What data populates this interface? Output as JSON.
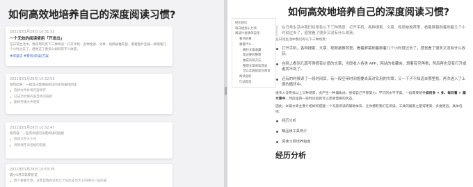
{
  "left": {
    "title": "如何高效地培养自己的深度阅读习惯?",
    "cards": [
      {
        "time": "2021年01月29日 10:51:53",
        "title": "一个无效的阅读使用「开发出」",
        "body": "在日常生活中，我常用的有下三种阅读：打开手机、各种搜索、文章、视频被推荐里，看着图片还被一刷刷看几个小时过去了。感觉这了要多么如何有不少收获。",
        "tags": "#阅读法  #要有/阅读/方案"
      },
      {
        "time": "2021年01月29日 10:52:55",
        "title": "经历起来：一般自己能做成阅读的主动查找阅读",
        "items": [
          "选择文件并将内容保存",
          "已成功文摘内容自动的链接",
          "删除存储文件链接"
        ]
      },
      {
        "time": "2021年01月29日 10:52:47",
        "title": "将内容：一些有价值的深度阅读的链接",
        "items": [
          "阅读文件大小对",
          "待到保存对话框的链接"
        ]
      },
      {
        "time": "2021年01月29日 10:53:36",
        "sub": "最小6月日常安装说",
        "items": [
          "尝下看看文章，注意自我阅读有几个在此成为大小同样的一些内容"
        ]
      }
    ]
  },
  "toc": [
    {
      "label": "经历经历",
      "level": 1
    },
    {
      "label": "每日规划十七项",
      "level": 1
    },
    {
      "label": "阅读计划清单安排",
      "level": 1
    },
    {
      "label": "看书的事",
      "level": 2
    },
    {
      "label": "要看什么…",
      "level": 2
    },
    {
      "label": "摘抄文章收藏",
      "level": 3
    },
    {
      "label": "笔记要有整理",
      "level": 3
    },
    {
      "label": "做成有效方法",
      "level": 3
    },
    {
      "label": "整理文章阅读目录",
      "level": 3
    },
    {
      "label": "可以实施前是对阅读",
      "level": 3
    },
    {
      "label": "阅读总结",
      "level": 2
    },
    {
      "label": "行动反思",
      "level": 2
    }
  ],
  "article": {
    "title": "如何高效地培养自己的深度阅读习惯?",
    "quote": "在日常生活中我们经常有以下三种场景：打开手机，各种搜索、文章、视频被推荐里，看着屏幕刷着刷着几个小时就过去了，感觉看了很多又没有什么收获。",
    "intro": "在日常生活中我们有以下三种场景：",
    "bullets": [
      "打开手机，各种搜索、文章、视频被推荐里，看着屏幕刷着刷着几个小时就过去了，感觉看了很多又没有什么收获。",
      "在网上看到几篇写得很有价值的文章，当即收入各类 APP，网站的收藏夹，想着有空再看，然后再也没有打开或者找不到了。",
      "还有的时候读了一段时间后，有一段空闲时间想要去真对实用的文章，又一下子不知道去哪里找，再次进入了上面的循环中。"
    ],
    "para1_start": "很多人没有找以上三种场景，会产生一种偏焦虑，觉得自己不够努力，学习的水平不高。一段需要培养",
    "para1_bold": "如何多 ✕ 多、每日看 ✕ 篇文章中",
    "para1_end": "，然后坚持一段时间后就可以走到需要的状态。",
    "para2": "因此，本篇文章主要介绍如何搭建一个深度阅读的辅助体系，让你拥有我们在阅读，工具的搬家之量得更高，多维更远，具体包括：",
    "short_list": [
      "经历分析",
      "精品读工具简介",
      "阅读习惯培养指南"
    ],
    "h2": "经历分析"
  }
}
